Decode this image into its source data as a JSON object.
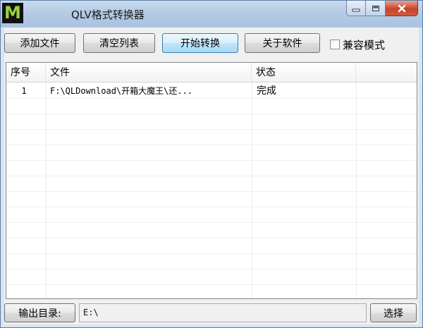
{
  "window": {
    "title": "QLV格式转换器",
    "app_icon_letter": "M"
  },
  "toolbar": {
    "add_file": "添加文件",
    "clear_list": "清空列表",
    "start_convert": "开始转换",
    "about": "关于软件",
    "compat_mode": "兼容模式"
  },
  "list": {
    "columns": [
      "序号",
      "文件",
      "状态"
    ],
    "rows": [
      {
        "index": "1",
        "file": "F:\\QLDownload\\开箱大魔王\\还...",
        "status": "完成"
      }
    ]
  },
  "output": {
    "label": "输出目录:",
    "path": "E:\\",
    "choose": "选择"
  }
}
